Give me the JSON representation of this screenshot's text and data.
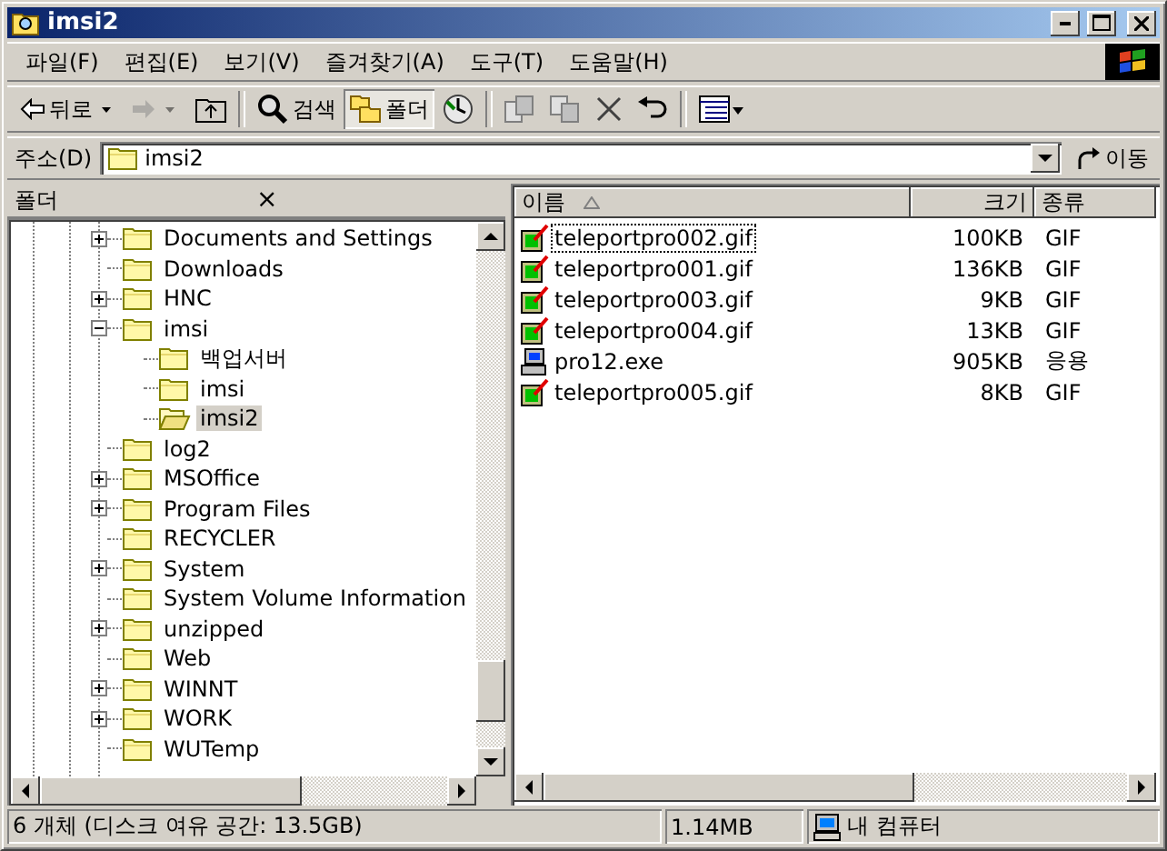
{
  "window": {
    "title": "imsi2"
  },
  "menu": [
    "파일(F)",
    "편집(E)",
    "보기(V)",
    "즐겨찾기(A)",
    "도구(T)",
    "도움말(H)"
  ],
  "toolbar": [
    {
      "kind": "back",
      "label": "뒤로",
      "disabled": false,
      "selected": false
    },
    {
      "kind": "forward",
      "disabled": true,
      "selected": false
    },
    {
      "kind": "up",
      "disabled": false,
      "selected": false
    },
    {
      "kind": "separator"
    },
    {
      "kind": "search",
      "label": "검색",
      "disabled": false,
      "selected": false
    },
    {
      "kind": "folders",
      "label": "폴더",
      "disabled": false,
      "selected": true
    },
    {
      "kind": "history",
      "disabled": false,
      "selected": false
    },
    {
      "kind": "separator"
    },
    {
      "kind": "move",
      "disabled": false,
      "selected": false
    },
    {
      "kind": "copy",
      "disabled": false,
      "selected": false
    },
    {
      "kind": "delete",
      "disabled": false,
      "selected": false
    },
    {
      "kind": "undo",
      "disabled": false,
      "selected": false
    },
    {
      "kind": "separator"
    },
    {
      "kind": "views",
      "disabled": false,
      "selected": false
    }
  ],
  "address": {
    "label": "주소(D)",
    "value": "imsi2",
    "go": "이동"
  },
  "folders_pane": {
    "title": "폴더",
    "close": "×",
    "tree": [
      {
        "label": "Documents and Settings",
        "expanded": false,
        "selected": false
      },
      {
        "label": "Downloads",
        "selected": false
      },
      {
        "label": "HNC",
        "expanded": false,
        "selected": false
      },
      {
        "label": "imsi",
        "expanded": true,
        "selected": false,
        "children": [
          {
            "label": "백업서버",
            "selected": false
          },
          {
            "label": "imsi",
            "selected": false
          },
          {
            "label": "imsi2",
            "selected": true
          }
        ]
      },
      {
        "label": "log2",
        "selected": false
      },
      {
        "label": "MSOffice",
        "expanded": false,
        "selected": false
      },
      {
        "label": "Program Files",
        "expanded": false,
        "selected": false
      },
      {
        "label": "RECYCLER",
        "selected": false
      },
      {
        "label": "System",
        "expanded": false,
        "selected": false
      },
      {
        "label": "System Volume Information",
        "selected": false
      },
      {
        "label": "unzipped",
        "expanded": false,
        "selected": false
      },
      {
        "label": "Web",
        "selected": false
      },
      {
        "label": "WINNT",
        "expanded": false,
        "selected": false
      },
      {
        "label": "WORK",
        "expanded": false,
        "selected": false
      },
      {
        "label": "WUTemp",
        "selected": false
      }
    ]
  },
  "file_list": {
    "columns": [
      {
        "label": "이름",
        "sorted": true
      },
      {
        "label": "크기",
        "sorted": false
      },
      {
        "label": "종류",
        "sorted": false
      }
    ],
    "rows": [
      {
        "kind": "gif",
        "name": "teleportpro002.gif",
        "size": "100KB",
        "type": "GIF",
        "focused": true
      },
      {
        "kind": "gif",
        "name": "teleportpro001.gif",
        "size": "136KB",
        "type": "GIF",
        "focused": false
      },
      {
        "kind": "gif",
        "name": "teleportpro003.gif",
        "size": "9KB",
        "type": "GIF",
        "focused": false
      },
      {
        "kind": "gif",
        "name": "teleportpro004.gif",
        "size": "13KB",
        "type": "GIF",
        "focused": false
      },
      {
        "kind": "exe",
        "name": "pro12.exe",
        "size": "905KB",
        "type": "응용",
        "focused": false
      },
      {
        "kind": "gif",
        "name": "teleportpro005.gif",
        "size": "8KB",
        "type": "GIF",
        "focused": false
      }
    ]
  },
  "status_bar": {
    "objects": "6 개체 (디스크 여유 공간: 13.5GB)",
    "size": "1.14MB",
    "zone": "내 컴퓨터"
  }
}
